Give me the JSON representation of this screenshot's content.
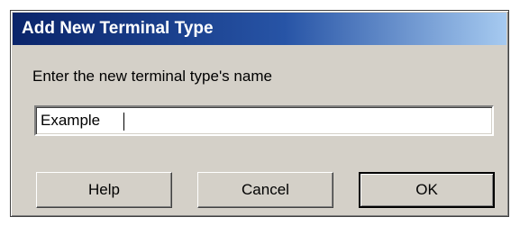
{
  "dialog": {
    "title": "Add New Terminal Type",
    "prompt": "Enter the new terminal type's name",
    "input_value": "Example",
    "buttons": {
      "help": "Help",
      "cancel": "Cancel",
      "ok": "OK"
    }
  },
  "colors": {
    "title_bar_start": "#0a246a",
    "title_bar_end": "#a6caf0",
    "dialog_face": "#d4d0c8"
  }
}
